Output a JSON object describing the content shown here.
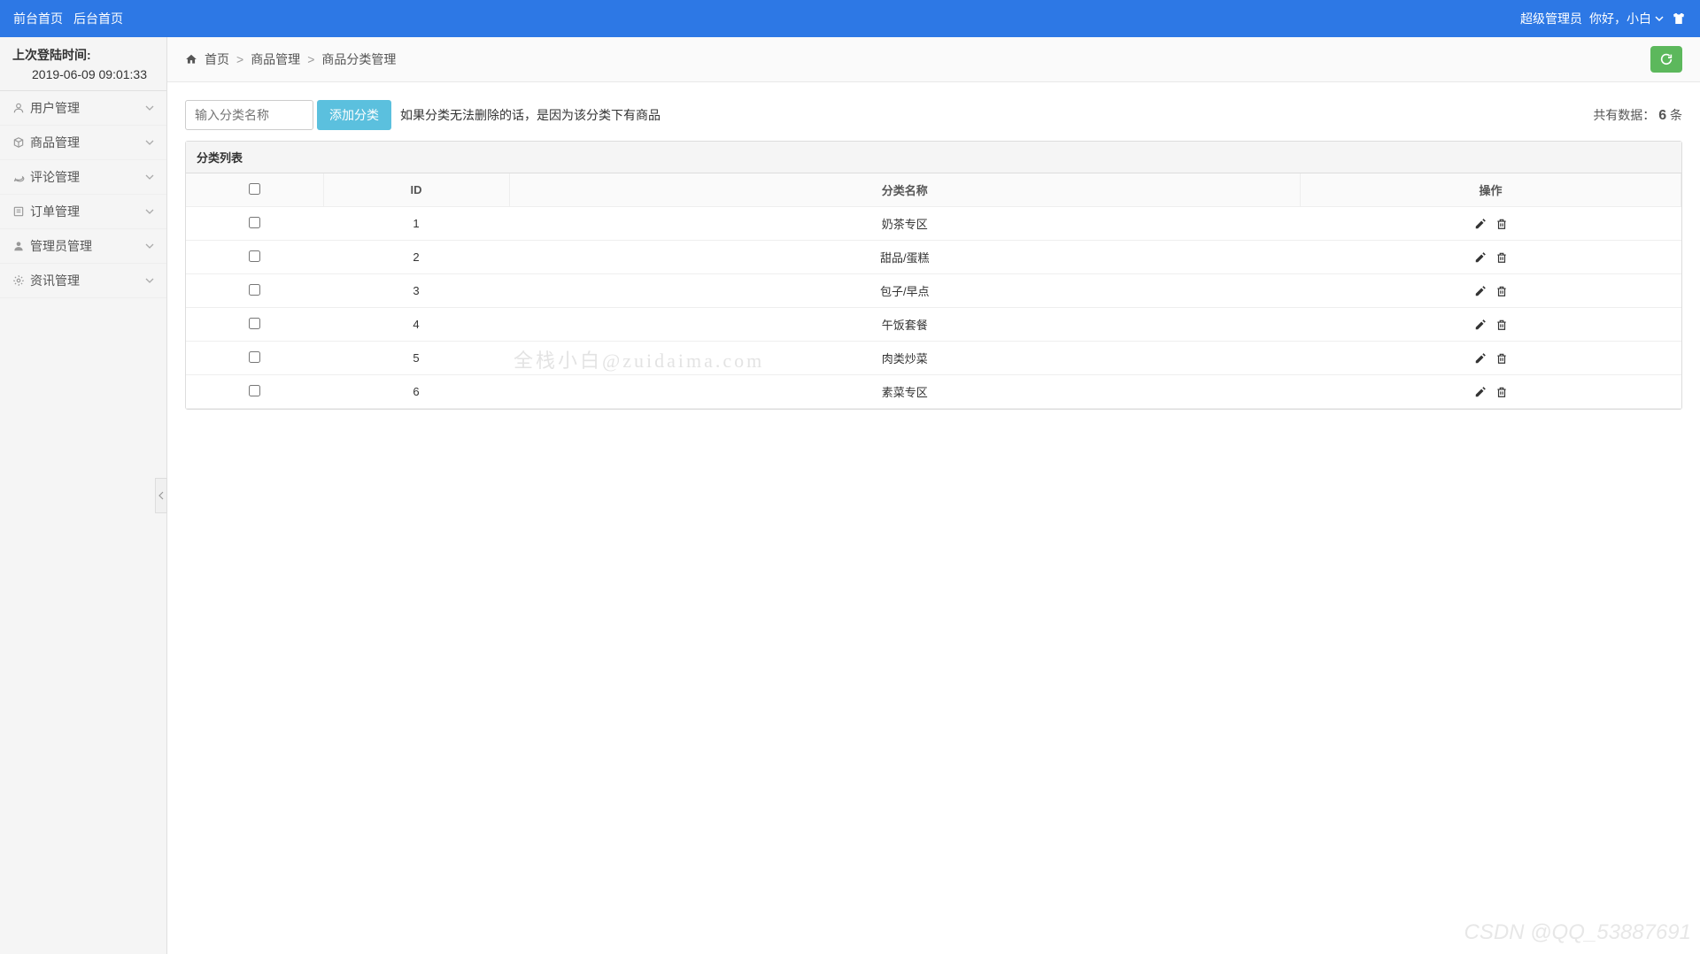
{
  "header": {
    "front_home": "前台首页",
    "back_home": "后台首页",
    "role": "超级管理员",
    "greeting": "你好，小白"
  },
  "sidebar": {
    "last_login_label": "上次登陆时间:",
    "last_login_value": "2019-06-09 09:01:33",
    "items": [
      {
        "label": "用户管理",
        "icon": "user"
      },
      {
        "label": "商品管理",
        "icon": "package"
      },
      {
        "label": "评论管理",
        "icon": "comment"
      },
      {
        "label": "订单管理",
        "icon": "order"
      },
      {
        "label": "管理员管理",
        "icon": "admin"
      },
      {
        "label": "资讯管理",
        "icon": "news"
      }
    ]
  },
  "breadcrumb": {
    "home": "首页",
    "level1": "商品管理",
    "level2": "商品分类管理"
  },
  "toolbar": {
    "input_placeholder": "输入分类名称",
    "add_btn": "添加分类",
    "hint": "如果分类无法删除的话，是因为该分类下有商品",
    "count_prefix": "共有数据：",
    "count_value": "6",
    "count_suffix": " 条"
  },
  "table": {
    "title": "分类列表",
    "headers": {
      "id": "ID",
      "name": "分类名称",
      "action": "操作"
    },
    "rows": [
      {
        "id": "1",
        "name": "奶茶专区"
      },
      {
        "id": "2",
        "name": "甜品/蛋糕"
      },
      {
        "id": "3",
        "name": "包子/早点"
      },
      {
        "id": "4",
        "name": "午饭套餐"
      },
      {
        "id": "5",
        "name": "肉类炒菜"
      },
      {
        "id": "6",
        "name": "素菜专区"
      }
    ]
  },
  "watermark": {
    "center": "全栈小白@zuidaima.com",
    "corner": "CSDN @QQ_53887691"
  }
}
